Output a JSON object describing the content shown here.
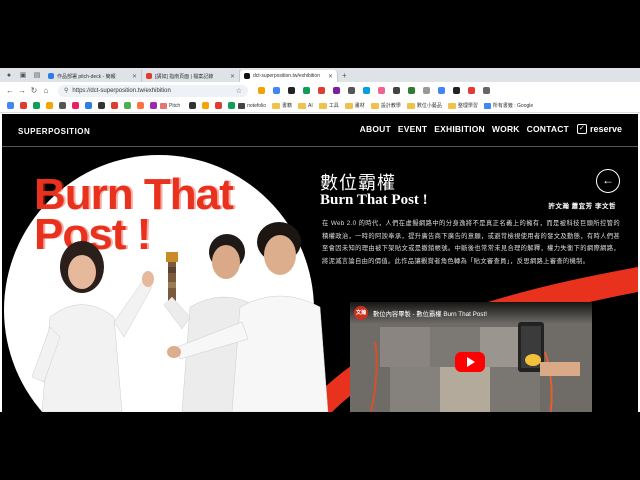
{
  "browser": {
    "tabs": [
      {
        "label": "作品部署 pitch-deck - 簡報",
        "color": "#2b7de9",
        "active": false
      },
      {
        "label": "[講如] 指南頁面 | 檔案記錄",
        "color": "#e03b2f",
        "active": false
      },
      {
        "label": "dct-superposition.tw/exhibition",
        "color": "#111111",
        "active": true
      }
    ],
    "new_tab": "+",
    "url": "https://dct-superposition.tw/exhibition",
    "bookmarks": [
      {
        "label": "notefolio",
        "type": "site",
        "color": "#444"
      },
      {
        "label": "書籍",
        "type": "folder"
      },
      {
        "label": "AI",
        "type": "folder"
      },
      {
        "label": "工具",
        "type": "folder"
      },
      {
        "label": "畫材",
        "type": "folder"
      },
      {
        "label": "設計教學",
        "type": "folder"
      },
      {
        "label": "數位小藝品",
        "type": "folder"
      },
      {
        "label": "整理學習",
        "type": "folder"
      },
      {
        "label": "所有書籤 : Google",
        "type": "site",
        "color": "#4285f4"
      }
    ],
    "pitch_label": "Pitch"
  },
  "site": {
    "logo": "SUPERPOSITION",
    "nav": [
      "ABOUT",
      "EVENT",
      "EXHIBITION",
      "WORK",
      "CONTACT"
    ],
    "reserve_label": "reserve",
    "back_icon": "arrow-left-icon",
    "hero_title": "Burn That Post !",
    "title_zh": "數位霸權",
    "title_en": "Burn That Post !",
    "authors": "許文瀚 蕭宜芳 李文哲",
    "description": "在 Web 2.0 的時代，人們在虛擬網路中的分身逸將不是真正名義上的擁有，而是被科技巨頭所控管的積權政治，一時的阿諛奉承，提升廣告商下廣告的意願，或避苛檢視使用者的發文及動態，有時人們甚至會因未知的理由被下架貼文或是撤銷帳號。中斷後也常常未見合理的解釋，權力失衡下的網際網路，將泥滅言論自由的價值。此作品讓觀賞者角色轉為「貼文審查員」，反思網路上審查的機制。",
    "video": {
      "channel": "文瀚",
      "title": "數位內容畢製 - 數位霸權 Burn That Post!"
    }
  },
  "colors": {
    "accent": "#e8321e",
    "background": "#000000"
  }
}
